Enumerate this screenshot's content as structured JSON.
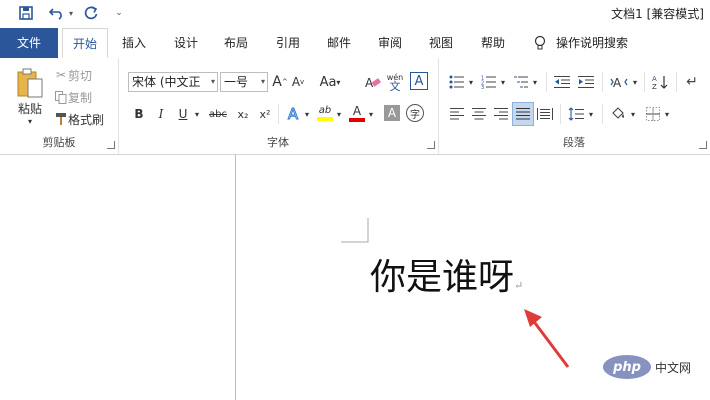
{
  "window": {
    "title": "文档1 [兼容模式]"
  },
  "quick_access": {
    "save_icon": "save-icon",
    "undo_icon": "undo-icon",
    "redo_icon": "redo-icon",
    "customize_icon": "customize-icon"
  },
  "tabs": {
    "file": "文件",
    "home": "开始",
    "insert": "插入",
    "design": "设计",
    "layout": "布局",
    "references": "引用",
    "mailings": "邮件",
    "review": "审阅",
    "view": "视图",
    "help": "帮助",
    "tell_me": "操作说明搜索"
  },
  "clipboard": {
    "label": "剪贴板",
    "paste": "粘贴",
    "cut": "剪切",
    "copy": "复制",
    "format_painter": "格式刷"
  },
  "font": {
    "label": "字体",
    "font_name": "宋体 (中文正",
    "font_size": "一号",
    "grow": "A",
    "shrink": "A",
    "change_case": "Aa",
    "phonetic_top": "wén",
    "phonetic_bottom": "文",
    "char_border": "A",
    "bold": "B",
    "italic": "I",
    "underline": "U",
    "strike": "abc",
    "subscript": "x₂",
    "superscript": "x²",
    "text_effect": "A",
    "highlight": "ab",
    "font_color": "A",
    "char_shading": "A",
    "enclose": "字",
    "highlight_color": "#ffff00",
    "font_color_value": "#e00000"
  },
  "paragraph": {
    "label": "段落"
  },
  "document": {
    "text": "你是谁呀",
    "mark": "↵"
  },
  "watermark": {
    "text": "php",
    "suffix": "中文网"
  }
}
